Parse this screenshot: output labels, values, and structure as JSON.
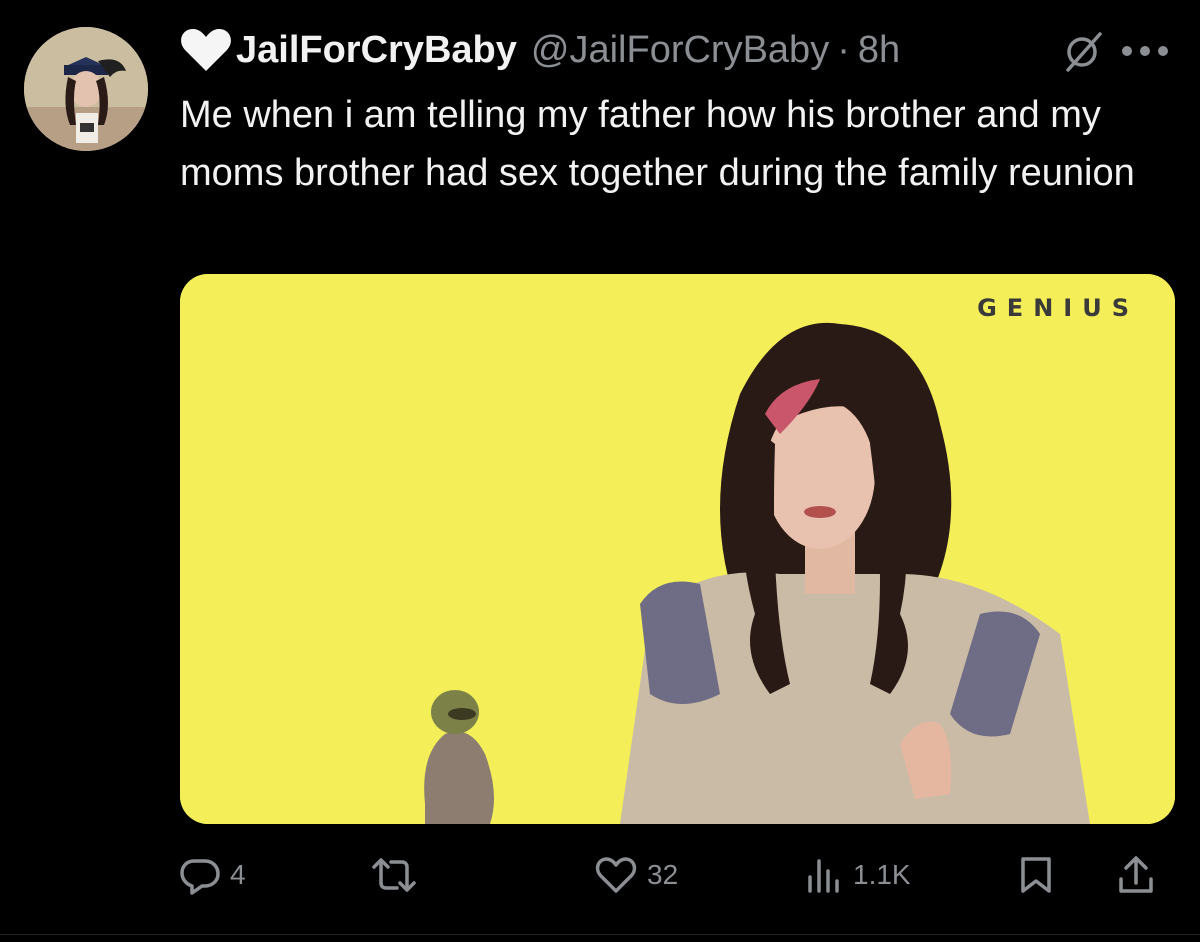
{
  "tweet": {
    "display_name": "JailForCryBaby",
    "handle": "@JailForCryBaby",
    "separator": "·",
    "timestamp": "8h",
    "text": "Me when i am telling my father how his brother and my moms brother had sex together during the family reunion"
  },
  "icons": {
    "name_prefix": "white-heart-icon",
    "grok": "grok-icon",
    "more": "more-options-icon",
    "reply": "reply-icon",
    "retweet": "retweet-icon",
    "like": "heart-outline-icon",
    "views": "views-icon",
    "bookmark": "bookmark-icon",
    "share": "share-icon"
  },
  "media": {
    "watermark": "GENIUS",
    "background_color": "#f4ef58"
  },
  "actions": {
    "replies": "4",
    "retweets": "",
    "likes": "32",
    "views": "1.1K"
  },
  "colors": {
    "background": "#000000",
    "text_primary": "#f2f2f2",
    "text_secondary": "#8b8f94"
  }
}
